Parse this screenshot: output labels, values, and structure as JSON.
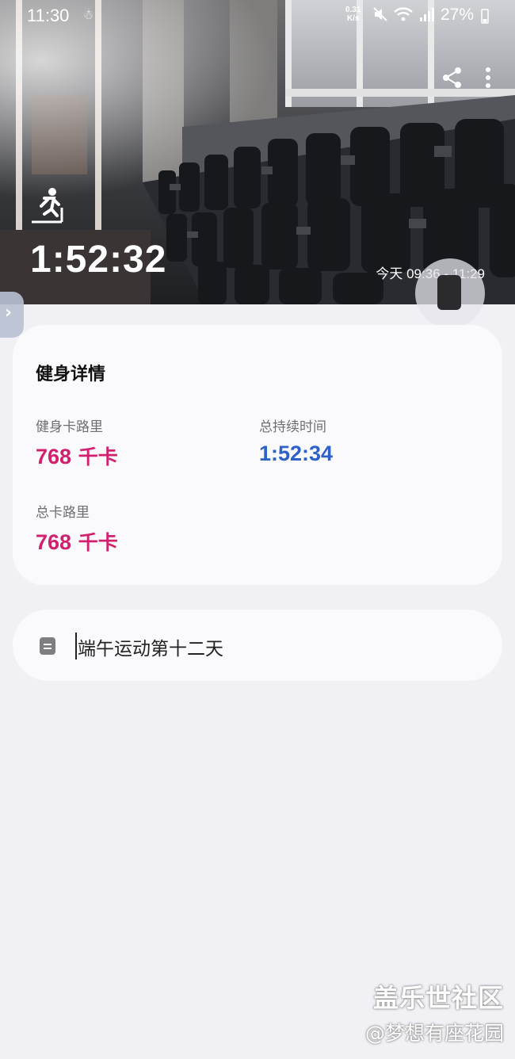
{
  "status_bar": {
    "time": "11:30",
    "net_speed_value": "0.31",
    "net_speed_unit": "K/s",
    "battery": "27%"
  },
  "hero": {
    "duration": "1:52:32",
    "date_range": "今天 09:36 - 11:29",
    "icons": [
      "share-icon",
      "more-vertical-icon",
      "treadmill-runner-icon"
    ]
  },
  "details": {
    "title": "健身详情",
    "workout_calories_label": "健身卡路里",
    "workout_calories_value": "768",
    "workout_calories_unit": " 千卡",
    "total_duration_label": "总持续时间",
    "total_duration_value": "1:52:34",
    "total_calories_label": "总卡路里",
    "total_calories_value": "768",
    "total_calories_unit": " 千卡"
  },
  "note": {
    "text": "端午运动第十二天"
  },
  "watermark": {
    "line1": "盖乐世社区",
    "line2": "@梦想有座花园"
  },
  "colors": {
    "calorie_accent": "#d0206e",
    "duration_accent": "#2d62c8",
    "page_background": "#f1f0f5"
  }
}
